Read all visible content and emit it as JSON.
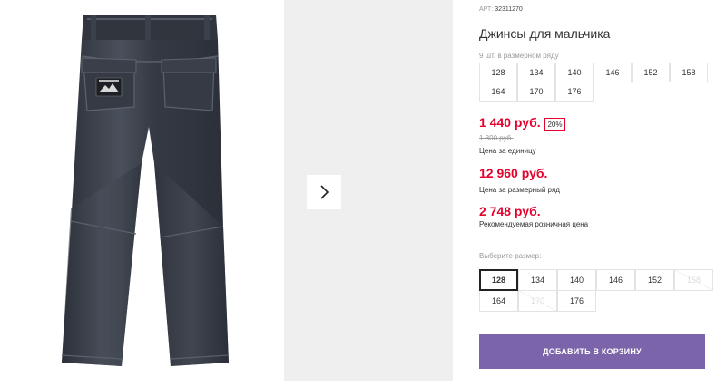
{
  "product": {
    "sku_label": "АРТ:",
    "sku_value": "32311270",
    "title": "Джинсы для мальчика",
    "pack_note": "9 шт. в размерном ряду",
    "pack_sizes": [
      "128",
      "134",
      "140",
      "146",
      "152",
      "158",
      "164",
      "170",
      "176"
    ]
  },
  "pricing": {
    "unit_price": "1 440 руб.",
    "discount_badge": "20%",
    "old_price": "1 800 руб.",
    "unit_label": "Цена за единицу",
    "pack_price": "12 960 руб.",
    "pack_label": "Цена за размерный ряд",
    "retail_price": "2 748 руб.",
    "retail_label": "Рекомендуемая розничная цена"
  },
  "size_select": {
    "label": "Выберите размер:",
    "sizes": [
      {
        "label": "128",
        "state": "selected"
      },
      {
        "label": "134",
        "state": "available"
      },
      {
        "label": "140",
        "state": "available"
      },
      {
        "label": "146",
        "state": "available"
      },
      {
        "label": "152",
        "state": "available"
      },
      {
        "label": "158",
        "state": "disabled"
      },
      {
        "label": "164",
        "state": "available"
      },
      {
        "label": "170",
        "state": "disabled"
      },
      {
        "label": "176",
        "state": "available"
      }
    ]
  },
  "actions": {
    "add_to_cart": "ДОБАВИТЬ В КОРЗИНУ"
  },
  "gallery": {
    "next_icon": "chevron-right-icon"
  },
  "colors": {
    "accent": "#7b64a9",
    "price": "#e4022d",
    "denim": "#2f3540"
  }
}
